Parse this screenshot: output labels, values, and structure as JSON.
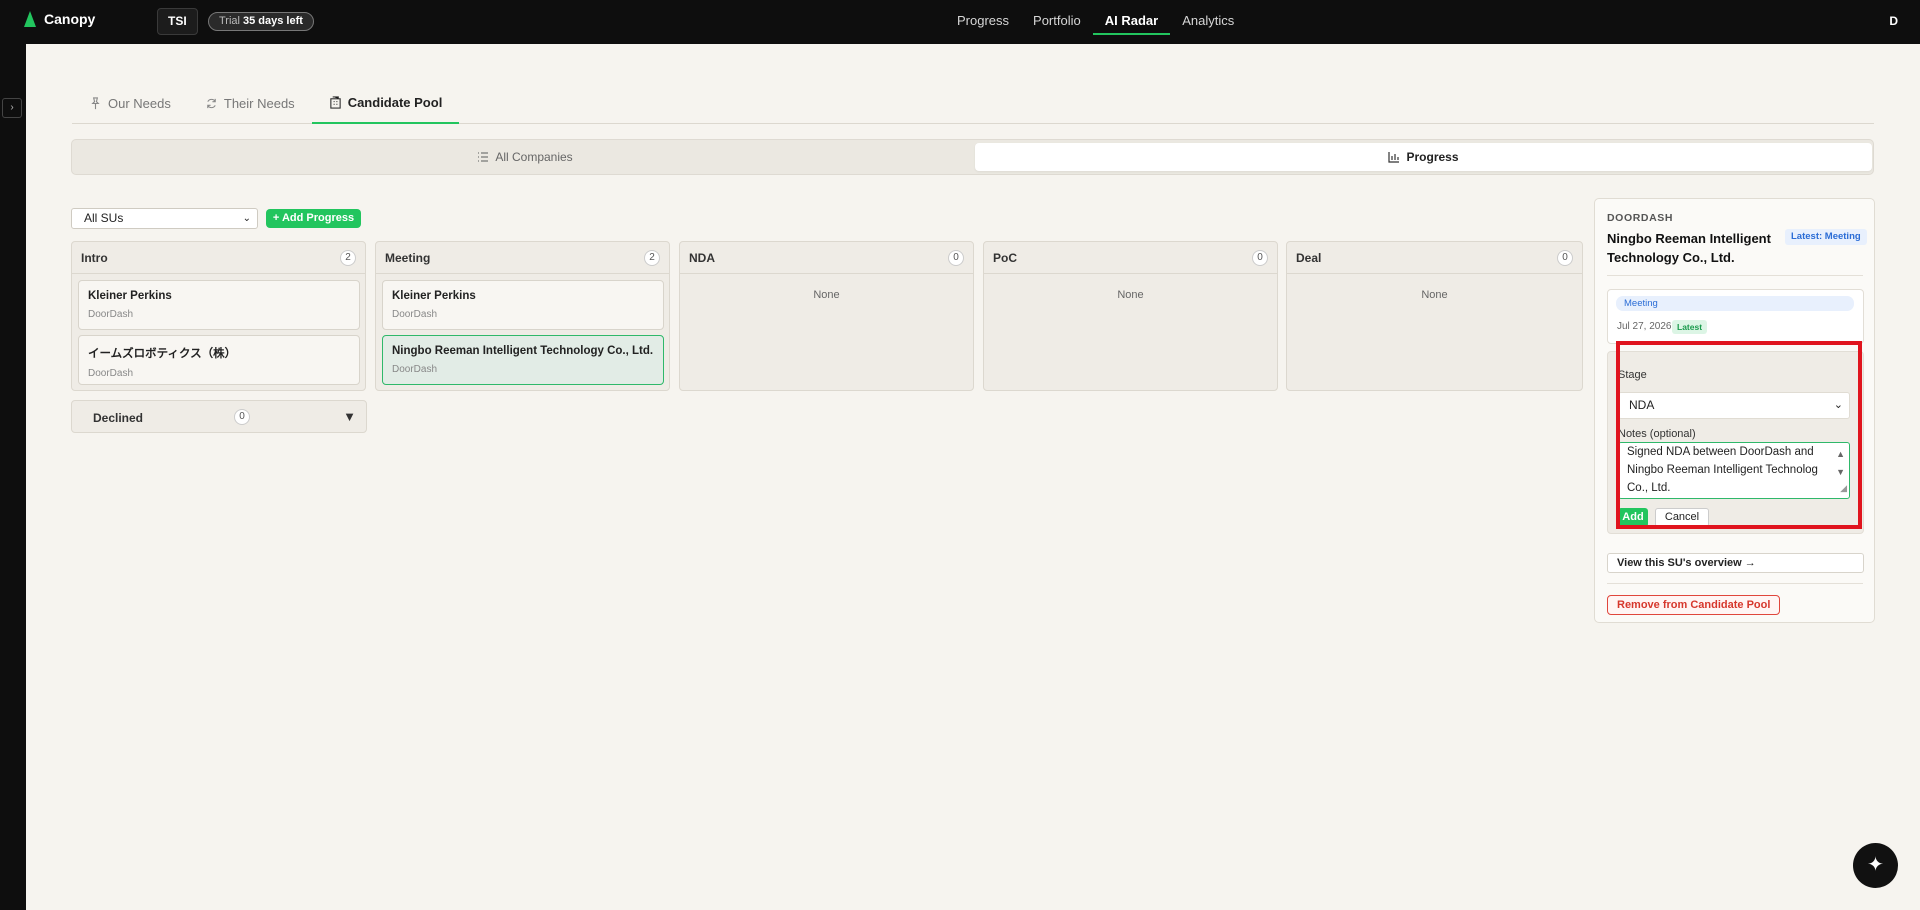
{
  "topbar": {
    "app_name": "Canopy",
    "workspace": "TSI",
    "trial_label": "Trial",
    "trial_value": "35 days left",
    "nav": [
      "Progress",
      "Portfolio",
      "AI Radar",
      "Analytics"
    ],
    "active_nav": "AI Radar",
    "user_initial": "D"
  },
  "rail": {
    "toggle": "›"
  },
  "subtabs": [
    "Our Needs",
    "Their Needs",
    "Candidate Pool"
  ],
  "view_toggle": {
    "all": "All Companies",
    "progress": "Progress"
  },
  "controls": {
    "su_filter": "All SUs",
    "add_progress": "+ Add Progress"
  },
  "kanban": {
    "none_label": "None",
    "columns": [
      {
        "name": "Intro",
        "count": "2",
        "cards": [
          {
            "title": "Kleiner Perkins",
            "sub": "DoorDash"
          },
          {
            "title": "イームズロボティクス（株）",
            "sub": "DoorDash"
          }
        ]
      },
      {
        "name": "Meeting",
        "count": "2",
        "cards": [
          {
            "title": "Kleiner Perkins",
            "sub": "DoorDash"
          },
          {
            "title": "Ningbo Reeman Intelligent Technology Co., Ltd.",
            "sub": "DoorDash"
          }
        ]
      },
      {
        "name": "NDA",
        "count": "0"
      },
      {
        "name": "PoC",
        "count": "0"
      },
      {
        "name": "Deal",
        "count": "0"
      }
    ],
    "declined": {
      "label": "Declined",
      "count": "0",
      "arrow": "▼"
    }
  },
  "panel": {
    "company": "DOORDASH",
    "title": "Ningbo Reeman Intelligent Technology Co., Ltd.",
    "latest_badge": "Latest: Meeting",
    "history": {
      "stage": "Meeting",
      "date": "Jul 27, 2026",
      "latest": "Latest"
    },
    "form": {
      "stage_label": "Stage",
      "stage_value": "NDA",
      "notes_label": "Notes (optional)",
      "notes_value": "Signed NDA between DoorDash and Ningbo Reeman Intelligent Technolog Co., Ltd.",
      "add": "Add",
      "cancel": "Cancel"
    },
    "overview": "View this SU's overview →",
    "remove": "Remove from Candidate Pool"
  },
  "fab": "✦"
}
